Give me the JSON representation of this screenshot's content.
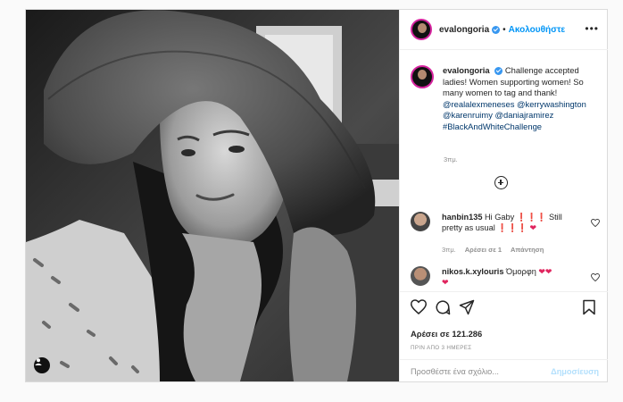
{
  "post": {
    "username": "evalongoria",
    "follow_label": "Ακολουθήστε",
    "dot": "•",
    "more_label": "•••",
    "caption": {
      "username": "evalongoria",
      "text": "Challenge accepted ladies! Women supporting women! So many women to tag and thank!",
      "mentions": [
        "@realalexmeneses",
        "@kerrywashington",
        "@karenruimy",
        "@daniajramirez"
      ],
      "hashtag": "#BlackAndWhiteChallenge",
      "time": "3πμ."
    },
    "comments": [
      {
        "username": "hanbin135",
        "text": "Hi Gaby",
        "emoji1": "❗❗❗",
        "text2": "Still pretty as usual",
        "emoji2": "❗❗❗",
        "heart": "❤",
        "time": "3πμ.",
        "likes": "Αρέσει σε 1",
        "reply": "Απάντηση"
      },
      {
        "username": "nikos.k.xylouris",
        "text": "Όμορφη",
        "emoji": "❤❤",
        "heart2": "❤"
      }
    ],
    "likes_text": "Αρέσει σε 121.286",
    "ago": "ΠΡΙΝ ΑΠΟ 3 ΗΜΕΡΕΣ",
    "add_comment_placeholder": "Προσθέστε ένα σχόλιο...",
    "post_label": "Δημοσίευση"
  },
  "colors": {
    "accent": "#0095f6",
    "verified": "#3897f0",
    "heart": "#e0245e"
  },
  "icons": [
    "user-tag-icon",
    "verified-icon",
    "add-icon",
    "heart-icon",
    "comment-icon",
    "share-icon",
    "bookmark-icon"
  ]
}
